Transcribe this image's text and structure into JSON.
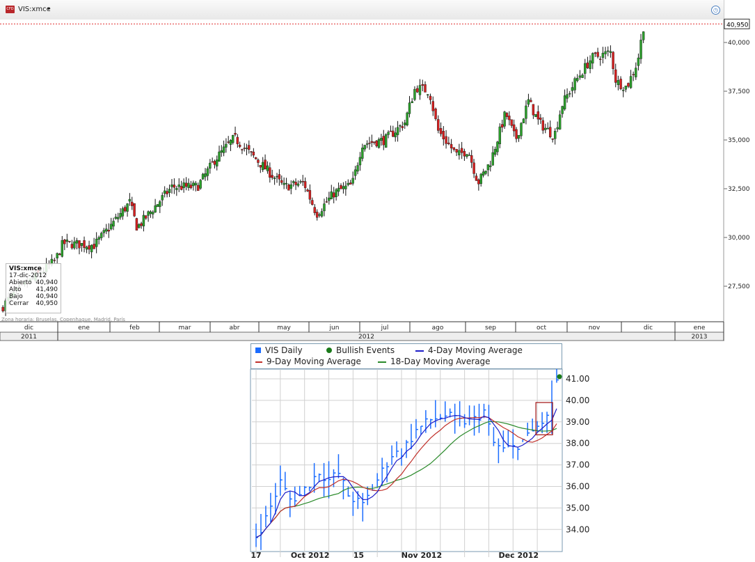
{
  "header": {
    "symbol": "VIS:xmce",
    "badge": "CFD",
    "caret": "▾"
  },
  "tooltip": {
    "symbol": "VIS:xmce",
    "date": "17-dic-2012",
    "rows": [
      {
        "label": "Abierto",
        "value": "40,940"
      },
      {
        "label": "Alto",
        "value": "41,490"
      },
      {
        "label": "Bajo",
        "value": "40,940"
      },
      {
        "label": "Cerrar",
        "value": "40,950"
      }
    ]
  },
  "timezone": "Zona horaria: Bruselas, Copenhague, Madrid, París",
  "last_price_label": "40,950",
  "colors": {
    "up": "#2ca02c",
    "down": "#d62020",
    "lastline": "#e03030",
    "blue": "#1a6cff",
    "ma4": "#1c1cc8",
    "ma9": "#c0302a",
    "ma18": "#2a8a2a"
  },
  "chart_data": [
    {
      "type": "candlestick",
      "title": "VIS:xmce",
      "ylim": [
        26000,
        41500
      ],
      "yticks": [
        "40,000",
        "37,500",
        "35,000",
        "32,500",
        "30,000",
        "27,500"
      ],
      "ytick_values": [
        40000,
        37500,
        35000,
        32500,
        30000,
        27500
      ],
      "months": [
        "dic",
        "ene",
        "feb",
        "mar",
        "abr",
        "may",
        "jun",
        "jul",
        "ago",
        "sep",
        "oct",
        "nov",
        "dic",
        "ene"
      ],
      "years": [
        "2011",
        "2012",
        "2013"
      ],
      "close_path": [
        [
          0,
          26300
        ],
        [
          0.2,
          27000
        ],
        [
          0.95,
          28800
        ],
        [
          1.1,
          29700
        ],
        [
          1.7,
          29600
        ],
        [
          2.4,
          31800
        ],
        [
          2.55,
          30500
        ],
        [
          3.25,
          32600
        ],
        [
          3.75,
          32600
        ],
        [
          4.1,
          34000
        ],
        [
          4.5,
          35100
        ],
        [
          4.95,
          34000
        ],
        [
          5.5,
          32600
        ],
        [
          5.9,
          32800
        ],
        [
          6.15,
          31200
        ],
        [
          6.5,
          32300
        ],
        [
          6.85,
          32700
        ],
        [
          7.05,
          34800
        ],
        [
          7.5,
          35000
        ],
        [
          7.9,
          35900
        ],
        [
          8.1,
          37700
        ],
        [
          8.35,
          37500
        ],
        [
          8.5,
          35500
        ],
        [
          8.85,
          34200
        ],
        [
          9.05,
          34500
        ],
        [
          9.25,
          32800
        ],
        [
          9.5,
          33900
        ],
        [
          9.8,
          36400
        ],
        [
          10,
          35000
        ],
        [
          10.25,
          37000
        ],
        [
          10.45,
          35900
        ],
        [
          10.75,
          35200
        ],
        [
          10.9,
          36800
        ],
        [
          11.15,
          38000
        ],
        [
          11.45,
          39200
        ],
        [
          11.8,
          39500
        ],
        [
          11.9,
          38000
        ],
        [
          12.1,
          37700
        ],
        [
          12.3,
          39000
        ],
        [
          12.42,
          40950
        ]
      ]
    },
    {
      "type": "bar",
      "title": "VIS Daily",
      "legend": [
        "VIS Daily",
        "Bullish Events",
        "4-Day Moving Average",
        "9-Day Moving Average",
        "18-Day Moving Average"
      ],
      "ylim": [
        33.5,
        41.5
      ],
      "yticks": [
        "41.00",
        "40.00",
        "39.00",
        "38.00",
        "37.00",
        "36.00",
        "35.00",
        "34.00"
      ],
      "ytick_values": [
        41,
        40,
        39,
        38,
        37,
        36,
        35,
        34
      ],
      "xlabels": [
        "17",
        "Oct 2012",
        "15",
        "Nov 2012",
        "Dec 2012"
      ],
      "xlabel_days": [
        0,
        10,
        20,
        33,
        53
      ],
      "close_path": [
        [
          0,
          33.7
        ],
        [
          2,
          34.5
        ],
        [
          5,
          36.2
        ],
        [
          7,
          35.4
        ],
        [
          9,
          35.6
        ],
        [
          13,
          36.7
        ],
        [
          15,
          36.3
        ],
        [
          17,
          36.6
        ],
        [
          19,
          35.6
        ],
        [
          22,
          35.1
        ],
        [
          25,
          36.3
        ],
        [
          28,
          37.5
        ],
        [
          30,
          37.6
        ],
        [
          33,
          38.6
        ],
        [
          36,
          39.1
        ],
        [
          39,
          39.3
        ],
        [
          42,
          39.0
        ],
        [
          45,
          39.1
        ],
        [
          47,
          39.5
        ],
        [
          49,
          38.0
        ],
        [
          51,
          37.7
        ],
        [
          53,
          37.8
        ],
        [
          56,
          38.3
        ],
        [
          59,
          39.0
        ],
        [
          61,
          39.3
        ],
        [
          62,
          40.95
        ]
      ],
      "bullish_event": {
        "day": 62,
        "value": 41.1
      }
    }
  ]
}
